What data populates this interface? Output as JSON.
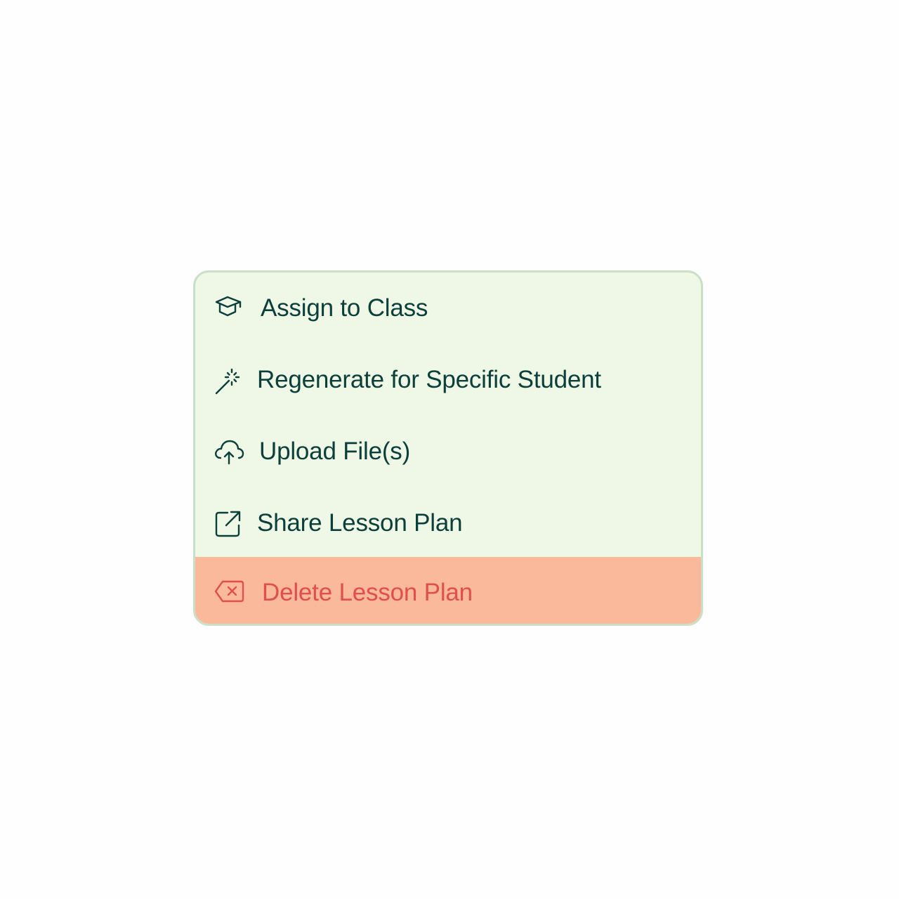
{
  "menu": {
    "items": [
      {
        "label": "Assign to Class",
        "icon": "graduation-cap-icon"
      },
      {
        "label": "Regenerate for Specific Student",
        "icon": "magic-wand-icon"
      },
      {
        "label": "Upload File(s)",
        "icon": "cloud-upload-icon"
      },
      {
        "label": "Share Lesson Plan",
        "icon": "external-share-icon"
      },
      {
        "label": "Delete Lesson Plan",
        "icon": "delete-backspace-icon"
      }
    ]
  },
  "colors": {
    "menu_background": "#eff7e6",
    "menu_border": "#c9dfc6",
    "text_primary": "#0b3f3a",
    "danger_background": "#fbb99b",
    "danger_text": "#e04e4e"
  }
}
